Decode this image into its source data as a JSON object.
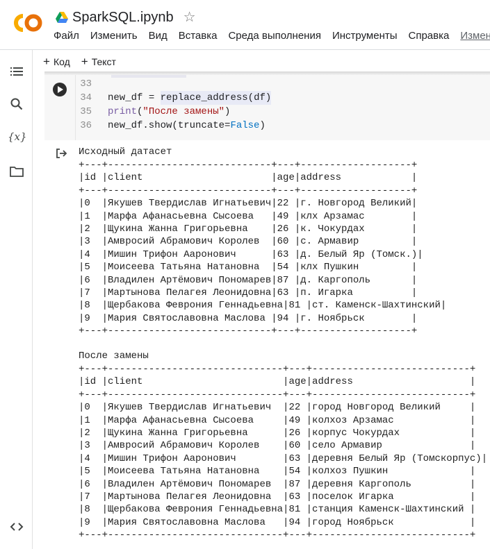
{
  "header": {
    "title": "SparkSQL.ipynb",
    "menu": [
      "Файл",
      "Изменить",
      "Вид",
      "Вставка",
      "Среда выполнения",
      "Инструменты",
      "Справка",
      "Измене"
    ]
  },
  "toolbar": {
    "code_label": "Код",
    "text_label": "Текст"
  },
  "rail": {
    "icons": [
      "table-of-contents-icon",
      "search-icon",
      "variables-icon",
      "files-icon",
      "code-snippets-icon"
    ]
  },
  "code_cell": {
    "line_numbers": [
      "33",
      "34",
      "35",
      "36"
    ],
    "line34": {
      "var": "new_df",
      "op": " = ",
      "call": "replace_address(df)"
    },
    "line35": {
      "fn": "print",
      "open": "(",
      "str": "\"После замены\"",
      "close": ")"
    },
    "line36": {
      "pre": "new_df.show(truncate=",
      "kw": "False",
      "post": ")"
    }
  },
  "output": {
    "label1": "Исходный датасет",
    "table1": [
      "+---+----------------------------+---+-------------------+",
      "|id |client                      |age|address            |",
      "+---+----------------------------+---+-------------------+",
      "|0  |Якушев Твердислав Игнатьевич|22 |г. Новгород Великий|",
      "|1  |Марфа Афанасьевна Сысоева   |49 |клх Арзамас        |",
      "|2  |Щукина Жанна Григорьевна    |26 |к. Чокурдах        |",
      "|3  |Амвросий Абрамович Королев  |60 |с. Армавир         |",
      "|4  |Мишин Трифон Ааронович      |63 |д. Белый Яр (Томск.)|",
      "|5  |Моисеева Татьяна Натановна  |54 |клх Пушкин         |",
      "|6  |Владилен Артёмович Пономарев|87 |д. Каргополь       |",
      "|7  |Мартынова Пелагея Леонидовна|63 |п. Игарка          |",
      "|8  |Щербакова Феврония Геннадьевна|81 |ст. Каменск-Шахтинский|",
      "|9  |Мария Святославовна Маслова |94 |г. Ноябрьск        |",
      "+---+----------------------------+---+-------------------+"
    ],
    "label2": "После замены",
    "table2": [
      "+---+------------------------------+---+---------------------------+",
      "|id |client                        |age|address                    |",
      "+---+------------------------------+---+---------------------------+",
      "|0  |Якушев Твердислав Игнатьевич  |22 |город Новгород Великий     |",
      "|1  |Марфа Афанасьевна Сысоева     |49 |колхоз Арзамас             |",
      "|2  |Щукина Жанна Григорьевна      |26 |корпус Чокурдах            |",
      "|3  |Амвросий Абрамович Королев    |60 |село Армавир               |",
      "|4  |Мишин Трифон Ааронович        |63 |деревня Белый Яр (Томскорпус)|",
      "|5  |Моисеева Татьяна Натановна    |54 |колхоз Пушкин              |",
      "|6  |Владилен Артёмович Пономарев  |87 |деревня Каргополь          |",
      "|7  |Мартынова Пелагея Леонидовна  |63 |поселок Игарка             |",
      "|8  |Щербакова Феврония Геннадьевна|81 |станция Каменск-Шахтинский |",
      "|9  |Мария Святославовна Маслова   |94 |город Ноябрьск             |",
      "+---+------------------------------+---+---------------------------+"
    ]
  }
}
